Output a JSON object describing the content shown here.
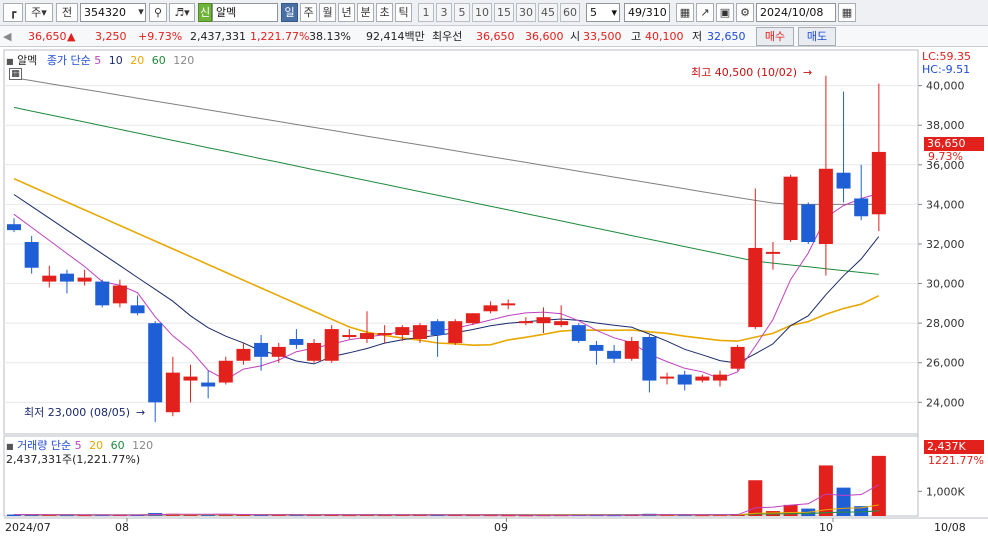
{
  "toolbar": {
    "type_label": "주",
    "all_label": "전",
    "code": "354320",
    "new_badge": "신",
    "name": "알멕",
    "period_tabs": [
      "일",
      "주",
      "월",
      "년",
      "분",
      "초",
      "틱"
    ],
    "minute_options": [
      "1",
      "3",
      "5",
      "10",
      "15",
      "30",
      "45",
      "60"
    ],
    "count_value": "5",
    "page_counter": "49/310",
    "date": "2024/10/08"
  },
  "quote": {
    "price": "36,650",
    "change_arrow": "▲",
    "change": "3,250",
    "change_pct": "+9.73%",
    "volume": "2,437,331",
    "volume_pct": "1,221.77%",
    "turnover_pct": "38.13%",
    "amount": "92,414백만",
    "best_label": "최우선",
    "best_ask": "36,650",
    "best_bid": "36,600",
    "open_label": "시",
    "open": "33,500",
    "high_label": "고",
    "high": "40,100",
    "low_label": "저",
    "low": "32,650",
    "buy_label": "매수",
    "sell_label": "매도"
  },
  "price_legend": {
    "name": "알멕",
    "ma_label": "종가 단순",
    "ma_periods": [
      "5",
      "10",
      "20",
      "60",
      "120"
    ]
  },
  "volume_legend": {
    "title": "거래량 단순",
    "ma_periods": [
      "5",
      "20",
      "60",
      "120"
    ],
    "info": "2,437,331주(1,221.77%)"
  },
  "indicators": {
    "lc": "LC:59.35",
    "hc": "HC:-9.51"
  },
  "current": {
    "price_tag": "36,650",
    "pct_tag": "9.73%",
    "vol_tag": "2,437K",
    "vol_pct_tag": "1221.77%"
  },
  "annotations": {
    "high": "최고 40,500 (10/02)",
    "low": "최저 23,000 (08/05)"
  },
  "x_labels": {
    "start": "2024/07",
    "m08": "08",
    "m09": "09",
    "m10": "10",
    "end": "10/08"
  },
  "colors": {
    "up": "#e2201c",
    "down": "#1f5fd6",
    "ma5": "#c040c0",
    "ma10": "#1a2a6a",
    "ma20": "#e8a800",
    "ma60": "#1e8a3c",
    "ma120": "#808080"
  },
  "chart_data": {
    "type": "candlestick",
    "y_ticks": [
      24000,
      26000,
      28000,
      30000,
      32000,
      34000,
      36000,
      38000,
      40000
    ],
    "ylim": [
      22400,
      41800
    ],
    "vol_ticks": [
      "1,000K"
    ],
    "vol_max": 3000000,
    "candles": [
      {
        "o": 33000,
        "h": 33300,
        "l": 32600,
        "c": 32700,
        "v": 60000
      },
      {
        "o": 32100,
        "h": 32400,
        "l": 30500,
        "c": 30800,
        "v": 55000
      },
      {
        "o": 30100,
        "h": 30900,
        "l": 29800,
        "c": 30400,
        "v": 40000
      },
      {
        "o": 30500,
        "h": 30700,
        "l": 29500,
        "c": 30100,
        "v": 38000
      },
      {
        "o": 30100,
        "h": 30700,
        "l": 29900,
        "c": 30300,
        "v": 35000
      },
      {
        "o": 30100,
        "h": 30200,
        "l": 28800,
        "c": 28900,
        "v": 50000
      },
      {
        "o": 29000,
        "h": 30200,
        "l": 28800,
        "c": 29900,
        "v": 42000
      },
      {
        "o": 28900,
        "h": 29400,
        "l": 28400,
        "c": 28500,
        "v": 45000
      },
      {
        "o": 28000,
        "h": 28100,
        "l": 23000,
        "c": 24000,
        "v": 120000
      },
      {
        "o": 23500,
        "h": 26300,
        "l": 23300,
        "c": 25500,
        "v": 90000
      },
      {
        "o": 25100,
        "h": 25900,
        "l": 24000,
        "c": 25300,
        "v": 60000
      },
      {
        "o": 25000,
        "h": 25600,
        "l": 24200,
        "c": 24800,
        "v": 50000
      },
      {
        "o": 25000,
        "h": 26300,
        "l": 24900,
        "c": 26100,
        "v": 55000
      },
      {
        "o": 26100,
        "h": 27000,
        "l": 25900,
        "c": 26700,
        "v": 48000
      },
      {
        "o": 27000,
        "h": 27400,
        "l": 25600,
        "c": 26300,
        "v": 52000
      },
      {
        "o": 26300,
        "h": 27000,
        "l": 26000,
        "c": 26800,
        "v": 40000
      },
      {
        "o": 27200,
        "h": 27700,
        "l": 26700,
        "c": 26900,
        "v": 45000
      },
      {
        "o": 26100,
        "h": 27200,
        "l": 26000,
        "c": 27000,
        "v": 47000
      },
      {
        "o": 26100,
        "h": 27900,
        "l": 26000,
        "c": 27700,
        "v": 70000
      },
      {
        "o": 27300,
        "h": 27700,
        "l": 27200,
        "c": 27400,
        "v": 35000
      },
      {
        "o": 27200,
        "h": 28600,
        "l": 27000,
        "c": 27500,
        "v": 60000
      },
      {
        "o": 27400,
        "h": 27900,
        "l": 27000,
        "c": 27500,
        "v": 38000
      },
      {
        "o": 27400,
        "h": 27900,
        "l": 27100,
        "c": 27800,
        "v": 40000
      },
      {
        "o": 27200,
        "h": 28000,
        "l": 27000,
        "c": 27900,
        "v": 42000
      },
      {
        "o": 28100,
        "h": 28200,
        "l": 26300,
        "c": 27400,
        "v": 50000
      },
      {
        "o": 27000,
        "h": 28200,
        "l": 26900,
        "c": 28100,
        "v": 55000
      },
      {
        "o": 28000,
        "h": 28500,
        "l": 27900,
        "c": 28500,
        "v": 38000
      },
      {
        "o": 28600,
        "h": 29100,
        "l": 28500,
        "c": 28900,
        "v": 36000
      },
      {
        "o": 28900,
        "h": 29200,
        "l": 28700,
        "c": 29000,
        "v": 30000
      },
      {
        "o": 28000,
        "h": 28300,
        "l": 27900,
        "c": 28100,
        "v": 28000
      },
      {
        "o": 28000,
        "h": 28800,
        "l": 27500,
        "c": 28300,
        "v": 34000
      },
      {
        "o": 27900,
        "h": 28900,
        "l": 27800,
        "c": 28100,
        "v": 36000
      },
      {
        "o": 27900,
        "h": 28000,
        "l": 27000,
        "c": 27100,
        "v": 40000
      },
      {
        "o": 26900,
        "h": 27100,
        "l": 25900,
        "c": 26600,
        "v": 38000
      },
      {
        "o": 26600,
        "h": 26900,
        "l": 26000,
        "c": 26200,
        "v": 35000
      },
      {
        "o": 26200,
        "h": 27300,
        "l": 26100,
        "c": 27100,
        "v": 42000
      },
      {
        "o": 27300,
        "h": 27400,
        "l": 24500,
        "c": 25100,
        "v": 90000
      },
      {
        "o": 25200,
        "h": 25500,
        "l": 24900,
        "c": 25300,
        "v": 45000
      },
      {
        "o": 25400,
        "h": 25600,
        "l": 24600,
        "c": 24900,
        "v": 40000
      },
      {
        "o": 25100,
        "h": 25400,
        "l": 25000,
        "c": 25300,
        "v": 35000
      },
      {
        "o": 25100,
        "h": 25600,
        "l": 24800,
        "c": 25400,
        "v": 38000
      },
      {
        "o": 25700,
        "h": 26900,
        "l": 25600,
        "c": 26800,
        "v": 80000
      },
      {
        "o": 27800,
        "h": 34800,
        "l": 27700,
        "c": 31800,
        "v": 1450000
      },
      {
        "o": 31500,
        "h": 32100,
        "l": 30700,
        "c": 31600,
        "v": 200000
      },
      {
        "o": 32200,
        "h": 35500,
        "l": 32100,
        "c": 35400,
        "v": 450000
      },
      {
        "o": 34000,
        "h": 34100,
        "l": 32000,
        "c": 32100,
        "v": 300000
      },
      {
        "o": 32000,
        "h": 40500,
        "l": 30400,
        "c": 35800,
        "v": 2050000
      },
      {
        "o": 35600,
        "h": 39700,
        "l": 34100,
        "c": 34800,
        "v": 1150000
      },
      {
        "o": 34300,
        "h": 36000,
        "l": 33200,
        "c": 33400,
        "v": 400000
      },
      {
        "o": 33500,
        "h": 40100,
        "l": 32650,
        "c": 36650,
        "v": 2437331
      }
    ]
  }
}
